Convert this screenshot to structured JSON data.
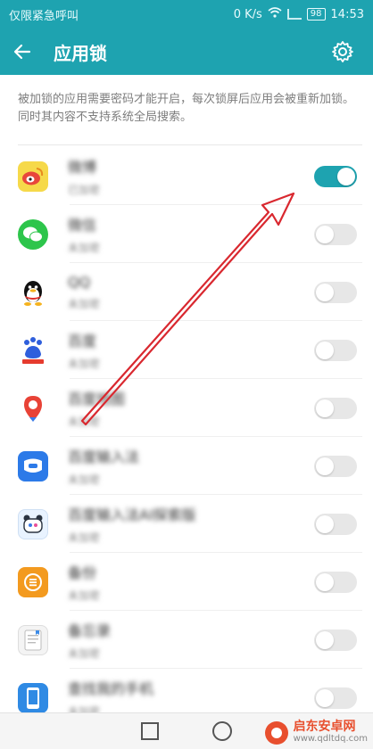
{
  "status_bar": {
    "carrier_text": "仅限紧急呼叫",
    "speed": "0 K/s",
    "battery": "98",
    "time": "14:53"
  },
  "app_bar": {
    "title": "应用锁"
  },
  "description": "被加锁的应用需要密码才能开启，每次锁屏后应用会被重新加锁。同时其内容不支持系统全局搜索。",
  "apps": [
    {
      "name": "微博",
      "status": "已加密",
      "locked": true
    },
    {
      "name": "微信",
      "status": "未加密",
      "locked": false
    },
    {
      "name": "QQ",
      "status": "未加密",
      "locked": false
    },
    {
      "name": "百度",
      "status": "未加密",
      "locked": false
    },
    {
      "name": "百度地图",
      "status": "未加密",
      "locked": false
    },
    {
      "name": "百度输入法",
      "status": "未加密",
      "locked": false
    },
    {
      "name": "百度输入法AI探索版",
      "status": "未加密",
      "locked": false
    },
    {
      "name": "备份",
      "status": "未加密",
      "locked": false
    },
    {
      "name": "备忘录",
      "status": "未加密",
      "locked": false
    },
    {
      "name": "查找我的手机",
      "status": "未加密",
      "locked": false
    }
  ],
  "watermark": {
    "main": "启东安卓网",
    "url": "www.qdltdq.com"
  },
  "colors": {
    "accent": "#1ea3b0",
    "annotation_arrow": "#d9282f"
  }
}
